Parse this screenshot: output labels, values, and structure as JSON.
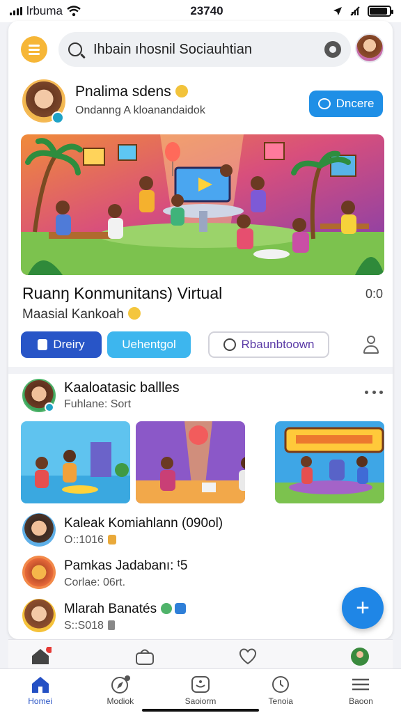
{
  "status": {
    "carrier": "lrbuma",
    "time": "23740"
  },
  "search": {
    "value": "Ihbain ıhosnil Sociauhtian"
  },
  "profile": {
    "name": "Pnalima sdens",
    "subtitle": "Ondanng  A  kloanandaidok",
    "follow_label": "Dncere"
  },
  "hero": {
    "title": "Ruanŋ Konmunitans) Virtual",
    "count": "0:0",
    "subtitle": "Maasial Kankoah"
  },
  "actions": {
    "join_label": "Dreiry",
    "chat_label": "Uehentgol",
    "discuss_label": "Rbaunbtoown"
  },
  "post": {
    "name": "Kaaloatasic ballles",
    "subtitle": "Fuhlane: Sort"
  },
  "list": [
    {
      "name": "Kaleak Komiahlann  (090ol)",
      "meta": "O::1016"
    },
    {
      "name": "Pamkas Jadabanı:  ᵗ5",
      "meta": "Corlae: 06rt."
    },
    {
      "name": "Mlarah Banatés",
      "meta": "S::S018"
    }
  ],
  "fab": {
    "label": "+"
  },
  "tabs": [
    {
      "label": "Homei",
      "icon": "home-icon"
    },
    {
      "label": "Modiok",
      "icon": "compass-icon"
    },
    {
      "label": "Saoiorm",
      "icon": "square-chat-icon"
    },
    {
      "label": "Tenoia",
      "icon": "clock-icon"
    },
    {
      "label": "Baoon",
      "icon": "menu-icon"
    }
  ],
  "colors": {
    "accent": "#1f86e6",
    "join": "#2855c7",
    "chat": "#3db6ee",
    "menu": "#f6b637"
  }
}
